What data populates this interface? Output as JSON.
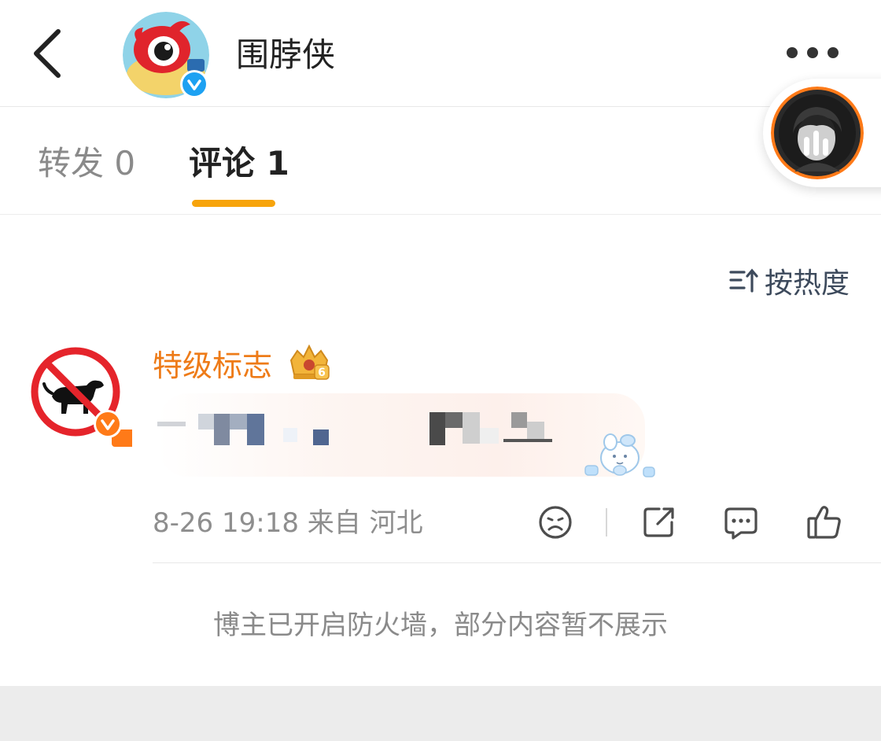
{
  "header": {
    "title": "围脖侠",
    "back_icon": "chevron-left-icon",
    "more_icon": "more-dots-icon",
    "verified_icon": "verified-v-icon"
  },
  "tabs": [
    {
      "label": "转发 0",
      "active": false
    },
    {
      "label": "评论 1",
      "active": true
    }
  ],
  "float_player": {
    "icon": "audio-bars-icon"
  },
  "sort": {
    "label": "按热度",
    "icon": "sort-icon"
  },
  "comments": [
    {
      "username": "特级标志",
      "badge_icon": "crown-level-icon",
      "badge_level": "6",
      "avatar_icon": "no-dog-sign-icon",
      "meta": "8-26 19:18  来自 河北",
      "actions": [
        "dislike-icon",
        "share-icon",
        "reply-icon",
        "like-icon"
      ]
    }
  ],
  "notice": "博主已开启防火墙，部分内容暂不展示",
  "colors": {
    "accent": "#f7a40c",
    "username": "#ee7b18",
    "verified_blue": "#1da1f2",
    "verified_orange": "#ff7a18",
    "muted": "#8a8a8a"
  }
}
